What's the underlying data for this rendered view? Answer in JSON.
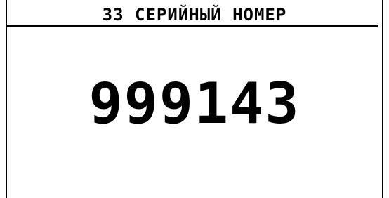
{
  "screen": {
    "title": "33 СЕРИЙНЫЙ НОМЕР",
    "value": "999143"
  },
  "colors": {
    "background": "#ffffff",
    "foreground": "#000000"
  }
}
